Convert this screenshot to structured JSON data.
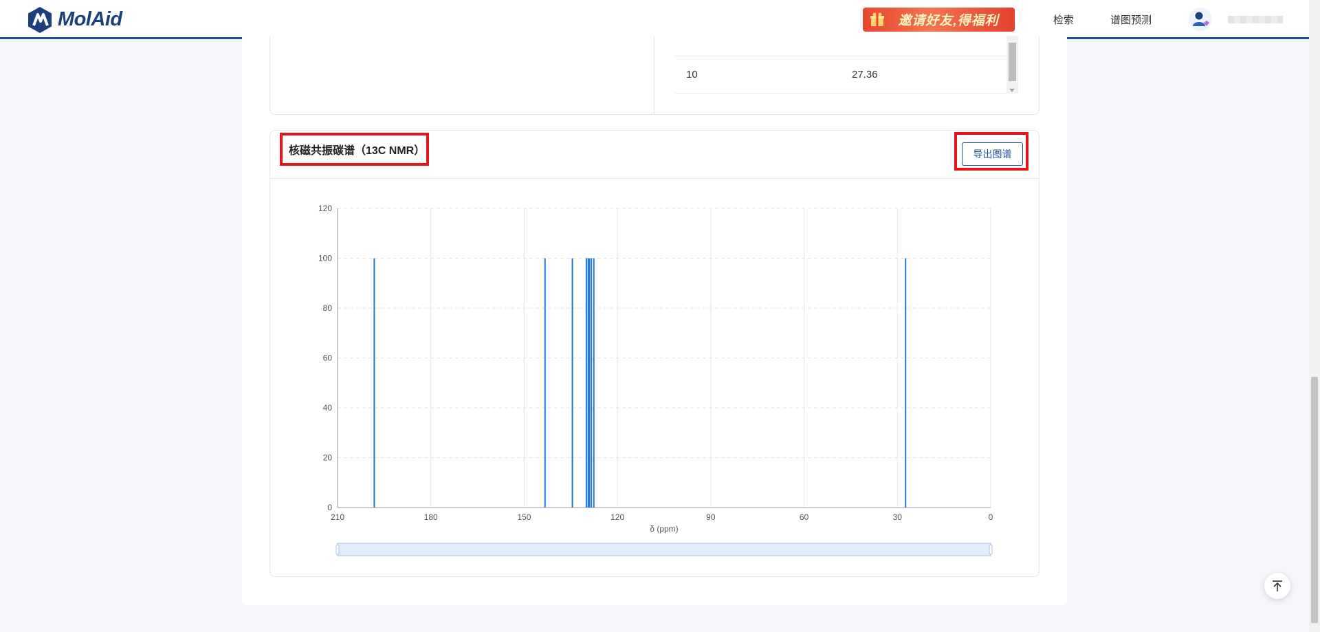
{
  "header": {
    "logo_text": "MolAid",
    "promo_text": "邀请好友,得福利",
    "nav": [
      "检索",
      "谱图预测"
    ],
    "accent_color": "#1d4f91"
  },
  "table": {
    "rows": [
      {
        "index": "10",
        "shift": "27.36"
      }
    ]
  },
  "nmr": {
    "title": "核磁共振碳谱（13C NMR）",
    "export_label": "导出图谱"
  },
  "chart_data": {
    "type": "bar",
    "xlabel": "δ (ppm)",
    "ylabel": "",
    "xlim": [
      210,
      0
    ],
    "ylim": [
      0,
      120
    ],
    "x_ticks": [
      210,
      180,
      150,
      120,
      90,
      60,
      30,
      0
    ],
    "y_ticks": [
      0,
      20,
      40,
      60,
      80,
      100,
      120
    ],
    "series": [
      {
        "x": [
          198.2,
          143.3,
          134.5,
          130.0,
          129.4,
          129.0,
          128.4,
          127.6,
          27.36
        ],
        "values": [
          100,
          100,
          100,
          100,
          100,
          100,
          100,
          100,
          100
        ]
      }
    ],
    "bar_color": "#1f78d1",
    "grid": true,
    "zoom_slider_range": [
      0,
      100
    ]
  },
  "icons": {
    "logo": "molaid-logo-icon",
    "promo": "gift-icon",
    "avatar": "user-avatar-icon",
    "back_to_top": "arrow-up-icon"
  }
}
